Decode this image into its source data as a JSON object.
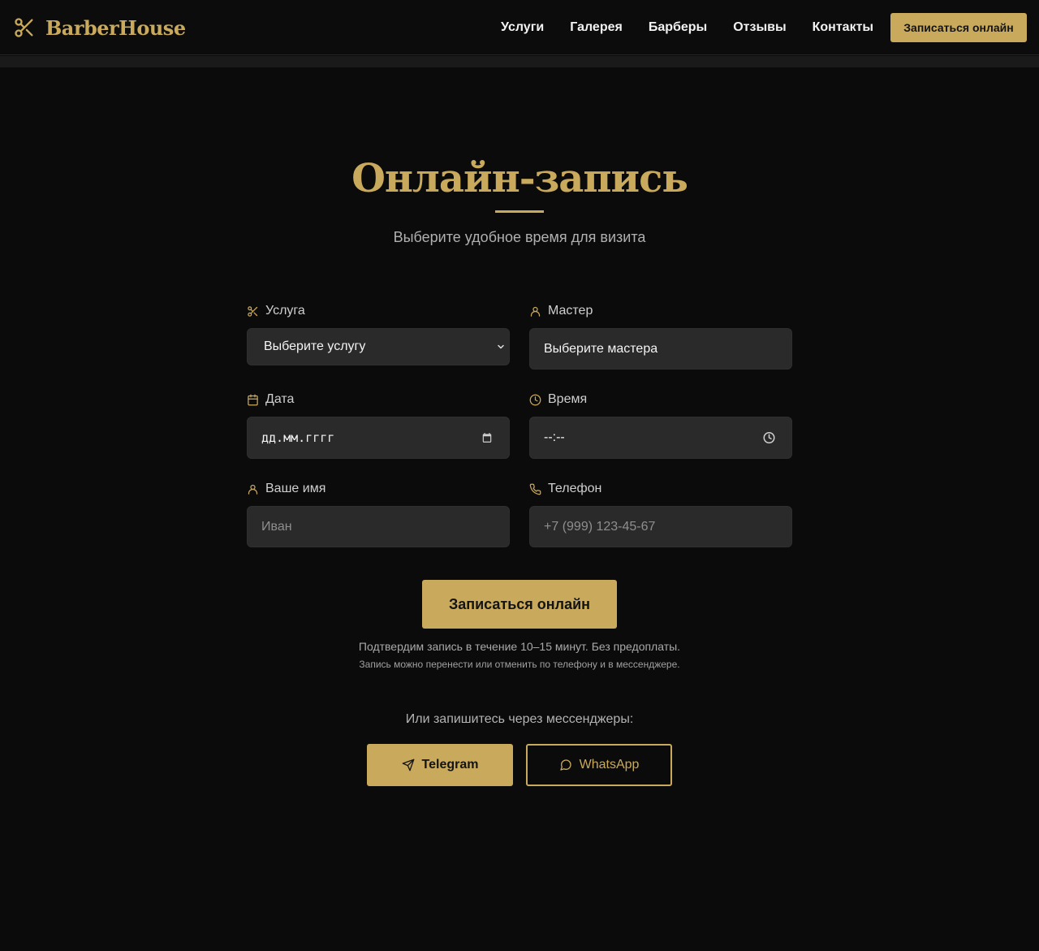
{
  "brand": {
    "name": "BarberHouse",
    "accent": "#c9a95b",
    "logo_icon": "scissors-icon"
  },
  "nav": {
    "items": [
      "Услуги",
      "Галерея",
      "Барберы",
      "Отзывы",
      "Контакты"
    ],
    "cta": "Записаться онлайн"
  },
  "hero": {
    "title": "Онлайн-запись",
    "subtitle": "Выберите удобное время для визита"
  },
  "form": {
    "service": {
      "label": "Услуга",
      "icon": "scissors-icon",
      "value": "Выберите услугу"
    },
    "master": {
      "label": "Мастер",
      "icon": "user-icon",
      "value": "Выберите мастера"
    },
    "date": {
      "label": "Дата",
      "icon": "calendar-icon",
      "value": "дд.мм.гггг"
    },
    "time": {
      "label": "Время",
      "icon": "clock-icon",
      "value": "--:--"
    },
    "name": {
      "label": "Ваше имя",
      "icon": "user-icon",
      "placeholder": "Иван"
    },
    "phone": {
      "label": "Телефон",
      "icon": "phone-icon",
      "placeholder": "+7 (999) 123-45-67"
    },
    "submit": "Записаться онлайн",
    "note_primary": "Подтвердим запись в течение 10–15 минут. Без предоплаты.",
    "note_secondary": "Запись можно перенести или отменить по телефону и в мессенджере."
  },
  "messengers": {
    "title": "Или запишитесь через мессенджеры:",
    "telegram": "Telegram",
    "whatsapp": "WhatsApp"
  }
}
